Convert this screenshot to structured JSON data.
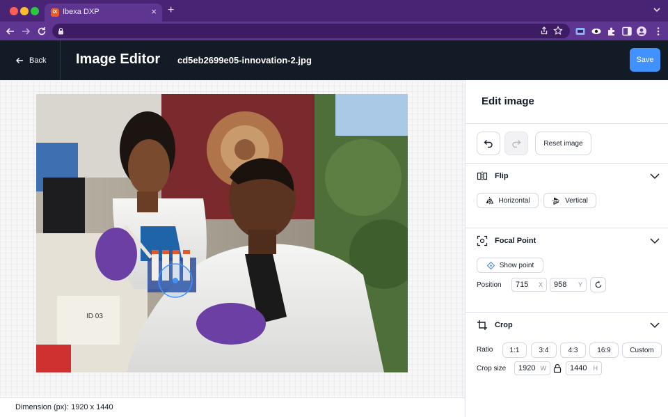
{
  "browser": {
    "tab_title": "Ibexa DXP",
    "tab_icon": "ibexa-favicon",
    "tab_close": "×",
    "new_tab": "+",
    "accent_color": "#5f3592"
  },
  "header": {
    "back_label": "Back",
    "title": "Image Editor",
    "file_name": "cd5eb2699e05-innovation-2.jpg",
    "save_label": "Save"
  },
  "footer": {
    "dimension_text": "Dimension (px): 1920 x 1440"
  },
  "panel": {
    "title": "Edit image",
    "reset_label": "Reset image",
    "flip": {
      "label": "Flip",
      "horizontal_label": "Horizontal",
      "vertical_label": "Vertical"
    },
    "focal_point": {
      "label": "Focal Point",
      "show_point_label": "Show point",
      "position_label": "Position",
      "x_value": "715",
      "x_unit": "X",
      "y_value": "958",
      "y_unit": "Y"
    },
    "crop": {
      "label": "Crop",
      "ratio_label": "Ratio",
      "ratios": [
        "1:1",
        "3:4",
        "4:3",
        "16:9",
        "Custom"
      ],
      "crop_size_label": "Crop size",
      "width_value": "1920",
      "width_unit": "W",
      "height_value": "1440",
      "height_unit": "H"
    }
  },
  "colors": {
    "header_bg": "#131c26",
    "save_bg": "#4191ff",
    "focal_accent": "#4191ff"
  }
}
